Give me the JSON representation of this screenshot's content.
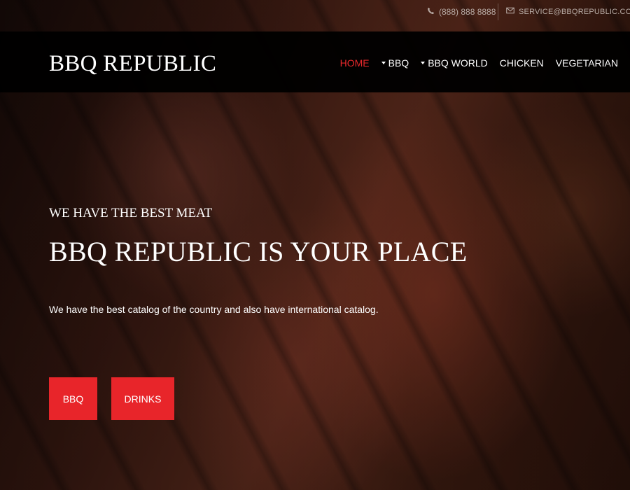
{
  "topbar": {
    "phone": "(888) 888 8888",
    "email": "SERVICE@BBQREPUBLIC.COM",
    "phone_icon": "phone-icon",
    "email_icon": "envelope-icon"
  },
  "nav": {
    "brand": "BBQ REPUBLIC",
    "items": [
      {
        "label": "HOME",
        "active": true,
        "dropdown": false
      },
      {
        "label": "BBQ",
        "active": false,
        "dropdown": true
      },
      {
        "label": "BBQ WORLD",
        "active": false,
        "dropdown": true
      },
      {
        "label": "CHICKEN",
        "active": false,
        "dropdown": false
      },
      {
        "label": "VEGETARIAN",
        "active": false,
        "dropdown": false
      }
    ]
  },
  "hero": {
    "kicker": "WE HAVE THE BEST MEAT",
    "headline": "BBQ REPUBLIC IS YOUR PLACE",
    "description": "We have the best catalog of the country and also have international catalog.",
    "buttons": [
      {
        "label": "BBQ"
      },
      {
        "label": "DRINKS"
      }
    ]
  },
  "colors": {
    "accent": "#e8252a",
    "active_nav": "#e8282b",
    "navbar_bg": "#000000",
    "text": "#ffffff"
  }
}
